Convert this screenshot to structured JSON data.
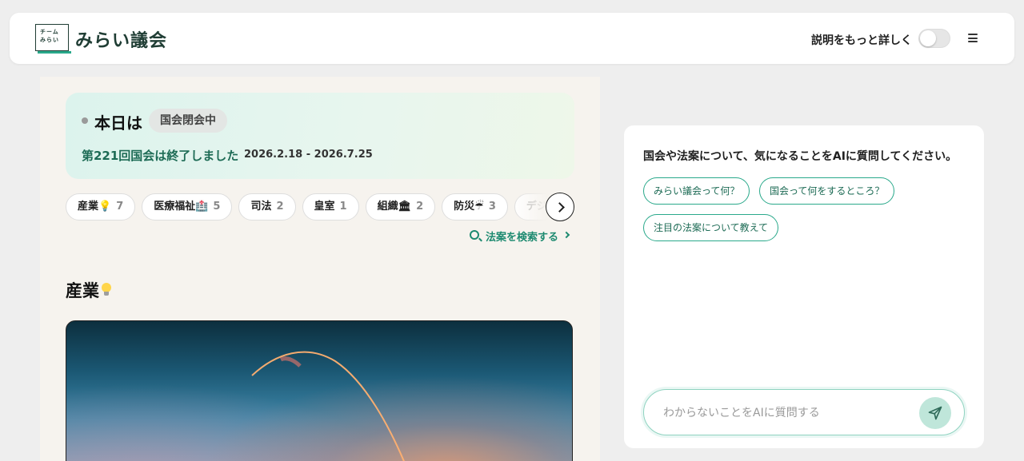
{
  "header": {
    "logo_line1": "チーム",
    "logo_line2": "みらい",
    "brand": "みらい議会",
    "explain_toggle_label": "説明をもっと詳しく",
    "explain_toggle_on": false
  },
  "status": {
    "today_label": "本日は",
    "badge": "国会閉会中",
    "session_text": "第221回国会は終了しました",
    "session_dates": "2026.2.18 - 2026.7.25"
  },
  "categories": [
    {
      "label": "産業💡",
      "count": "7"
    },
    {
      "label": "医療福祉🏥",
      "count": "5"
    },
    {
      "label": "司法",
      "count": "2"
    },
    {
      "label": "皇室",
      "count": "1"
    },
    {
      "label": "組織🏛",
      "count": "2"
    },
    {
      "label": "防災☔",
      "count": "3"
    },
    {
      "label": "デジ",
      "count": ""
    }
  ],
  "search_link": "法案を検索する",
  "section": {
    "title": "産業",
    "icon": "lightbulb-icon"
  },
  "chat": {
    "intro": "国会や法案について、気になることをAIに質問してください。",
    "suggestions": [
      "みらい議会って何？",
      "国会って何をするところ？",
      "注目の法案について教えて"
    ],
    "input_placeholder": "わからないことをAIに質問する"
  },
  "colors": {
    "accent": "#2aa98b",
    "accent_dark": "#1d6b55",
    "panel_bg": "#f6f3ee",
    "page_bg": "#eeeeee"
  }
}
